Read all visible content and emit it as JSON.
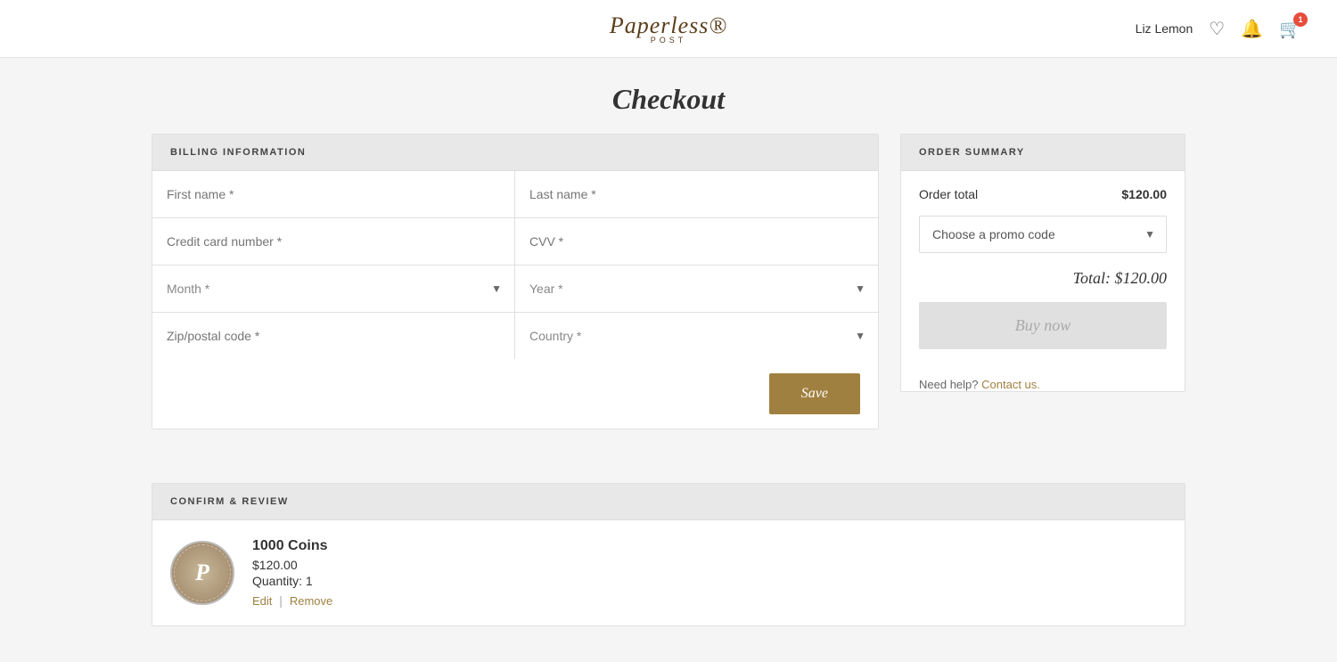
{
  "header": {
    "logo_text": "Paperless®",
    "logo_sub": "POST",
    "username": "Liz Lemon",
    "cart_count": "1"
  },
  "page": {
    "title": "Checkout"
  },
  "billing": {
    "section_title": "BILLING INFORMATION",
    "first_name_placeholder": "First name *",
    "last_name_placeholder": "Last name *",
    "credit_card_placeholder": "Credit card number *",
    "cvv_placeholder": "CVV *",
    "month_placeholder": "Month *",
    "year_placeholder": "Year *",
    "zip_placeholder": "Zip/postal code *",
    "country_placeholder": "Country *",
    "save_label": "Save"
  },
  "order_summary": {
    "section_title": "ORDER SUMMARY",
    "order_total_label": "Order total",
    "order_total_amount": "$120.00",
    "promo_placeholder": "Choose a promo code",
    "total_label": "Total: $120.00",
    "buy_now_label": "Buy now",
    "need_help_text": "Need help?",
    "contact_us_text": "Contact us."
  },
  "confirm": {
    "section_title": "CONFIRM & REVIEW",
    "product_logo_letter": "P",
    "product_name": "1000 Coins",
    "product_price": "$120.00",
    "product_quantity": "Quantity: 1",
    "edit_label": "Edit",
    "remove_label": "Remove"
  }
}
